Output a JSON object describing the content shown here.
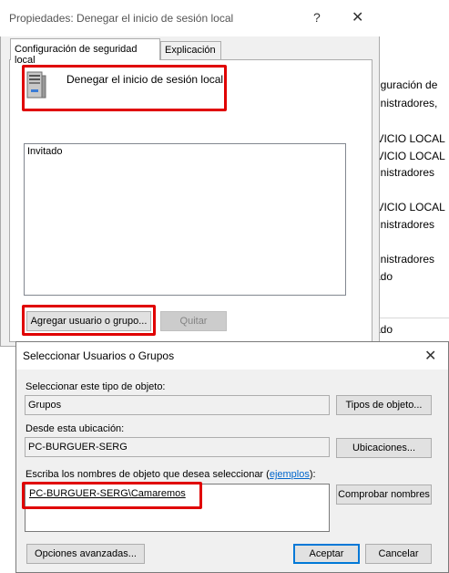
{
  "background": {
    "lines": [
      "nfiguración de",
      "ministradores,",
      "RVICIO LOCAL",
      "RVICIO LOCAL",
      "ministradores",
      "RVICIO LOCAL",
      "ministradores",
      "ministradores",
      "itado",
      "itado"
    ]
  },
  "properties_dialog": {
    "title": "Propiedades: Denegar el inicio de sesión local",
    "help_glyph": "?",
    "close_glyph": "✕",
    "tabs": [
      "Configuración de seguridad local",
      "Explicación"
    ],
    "policy_name": "Denegar el inicio de sesión local",
    "members": [
      "Invitado"
    ],
    "add_button": "Agregar usuario o grupo...",
    "remove_button": "Quitar"
  },
  "select_dialog": {
    "title": "Seleccionar Usuarios o Grupos",
    "close_glyph": "✕",
    "object_type_label": "Seleccionar este tipo de objeto:",
    "object_type_value": "Grupos",
    "object_types_button": "Tipos de objeto...",
    "location_label": "Desde esta ubicación:",
    "location_value": "PC-BURGUER-SERG",
    "locations_button": "Ubicaciones...",
    "names_label_prefix": "Escriba los nombres de objeto que desea seleccionar (",
    "names_label_link": "ejemplos",
    "names_label_suffix": "):",
    "names_value": "PC-BURGUER-SERG\\Camaremos",
    "check_names_button": "Comprobar nombres",
    "advanced_button": "Opciones avanzadas...",
    "ok_button": "Aceptar",
    "cancel_button": "Cancelar"
  },
  "colors": {
    "highlight": "#e00000",
    "link": "#0066cc",
    "default_button_border": "#0078d7"
  }
}
